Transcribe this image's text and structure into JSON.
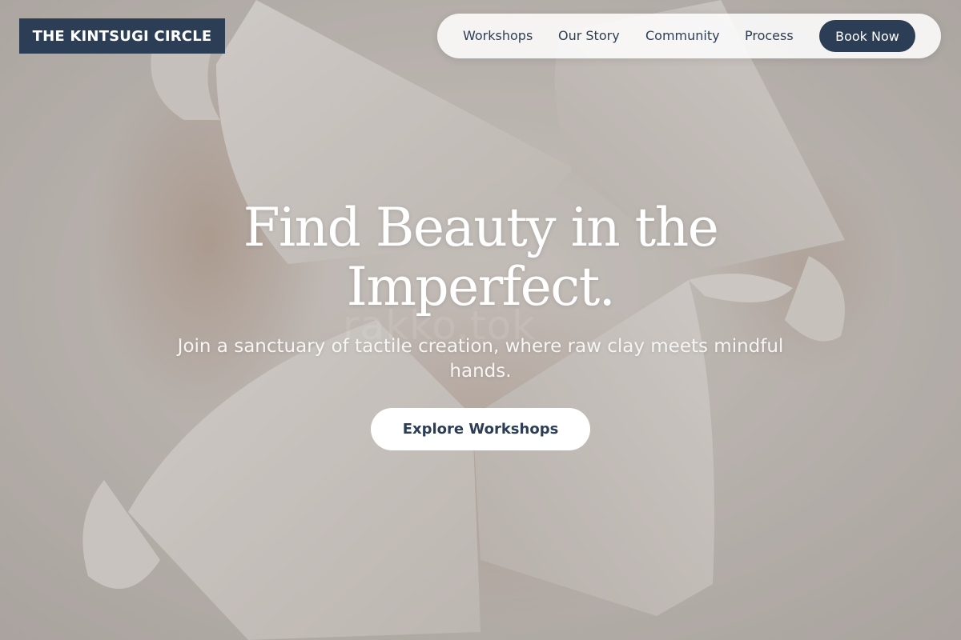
{
  "brand": {
    "name": "THE KINTSUGI CIRCLE"
  },
  "nav": {
    "links": [
      "Workshops",
      "Our Story",
      "Community",
      "Process"
    ],
    "book_label": "Book Now"
  },
  "hero": {
    "headline": "Find Beauty in the Imperfect.",
    "subhead": "Join a sanctuary of tactile creation, where raw clay meets mindful hands.",
    "cta_label": "Explore Workshops",
    "watermark": "rakko.tok"
  },
  "colors": {
    "navy": "#2c3e55",
    "clay": "#e6e1dc",
    "background": "#cfcac5"
  }
}
